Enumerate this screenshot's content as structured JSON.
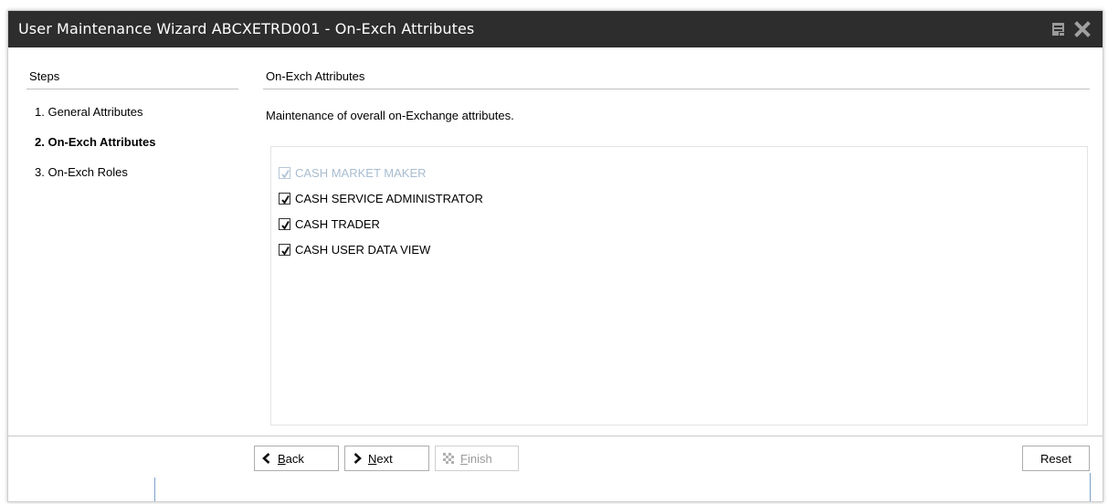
{
  "window": {
    "title": "User Maintenance Wizard ABCXETRD001 - On-Exch Attributes",
    "icons": [
      "restore-icon",
      "close-icon"
    ]
  },
  "steps": {
    "header": "Steps",
    "items": [
      {
        "label": "1.  General Attributes",
        "active": false
      },
      {
        "label": "2.  On-Exch Attributes",
        "active": true
      },
      {
        "label": "3.  On-Exch Roles",
        "active": false
      }
    ]
  },
  "content": {
    "header": "On-Exch Attributes",
    "description": "Maintenance of overall on-Exchange attributes.",
    "attributes": [
      {
        "label": "CASH MARKET MAKER",
        "checked": true,
        "enabled": false
      },
      {
        "label": "CASH SERVICE ADMINISTRATOR",
        "checked": true,
        "enabled": true
      },
      {
        "label": "CASH TRADER",
        "checked": true,
        "enabled": true
      },
      {
        "label": "CASH USER DATA VIEW",
        "checked": true,
        "enabled": true
      }
    ]
  },
  "buttons": {
    "back": {
      "mnemonic": "B",
      "rest": "ack",
      "icon": "chevron-left-icon"
    },
    "next": {
      "mnemonic": "N",
      "rest": "ext",
      "icon": "chevron-right-icon"
    },
    "finish": {
      "mnemonic": "F",
      "rest": "inish",
      "icon": "checkered-flag-icon",
      "enabled": false
    },
    "reset": "Reset"
  },
  "colors": {
    "titlebar": "#2d2d2d",
    "disabled_text": "#a8bccf",
    "accent_line": "#7aa2c8"
  }
}
